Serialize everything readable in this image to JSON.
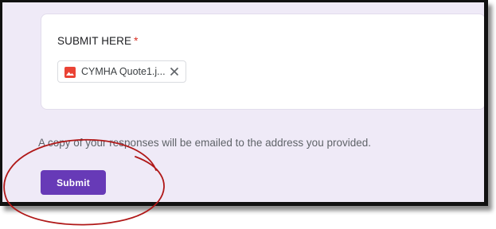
{
  "question": {
    "title": "SUBMIT HERE",
    "required_marker": "*"
  },
  "upload": {
    "file_name": "CYMHA Quote1.j...",
    "file_icon": "image-file-icon",
    "remove_icon": "close-icon"
  },
  "notice": "A copy of your responses will be emailed to the address you provided.",
  "actions": {
    "submit_label": "Submit"
  },
  "colors": {
    "accent": "#673ab7",
    "background": "#efeaf7",
    "required": "#d93025",
    "annotation_circle": "#b01818"
  }
}
